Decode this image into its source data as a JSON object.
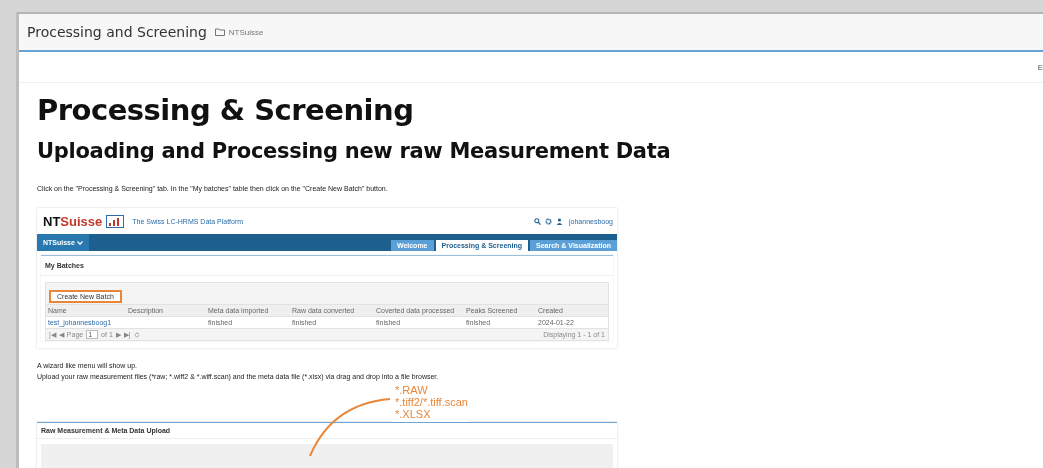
{
  "page_header": {
    "title": "Processing and Screening",
    "folder": "NTSuisse"
  },
  "toolbar": {
    "cut_text": "E"
  },
  "heading": "Processing & Screening",
  "subheading": "Uploading and Processing new raw Measurement Data",
  "intro": "Click on the \"Processing & Screening\" tab. In the \"My batches\" table then click on the \"Create New Batch\" button.",
  "screenshot_1": {
    "logo": [
      {
        "text": "NT",
        "kind": "dark"
      },
      {
        "text": "Suisse",
        "kind": "accent"
      }
    ],
    "tagline": "The Swiss LC-HRMS Data Platform",
    "user": "johannesboog",
    "menu": "NTSuisse",
    "tabs": [
      {
        "label": "Welcome",
        "selected": false
      },
      {
        "label": "Processing & Screening",
        "selected": true
      },
      {
        "label": "Search & Visualization",
        "selected": false
      }
    ],
    "panel_title": "My Batches",
    "button": "Create New Batch",
    "columns": [
      "Name",
      "Description",
      "Meta data imported",
      "Raw data converted",
      "Coverted data processed",
      "Peaks Screened",
      "Created"
    ],
    "rows": [
      [
        "test_johannesboog1",
        "",
        "finished",
        "finished",
        "finished",
        "finished",
        "2024-01-22"
      ]
    ],
    "pager": {
      "first": "|◀",
      "previous": "◀",
      "next": "▶",
      "last": "▶|",
      "page_label": "Page",
      "page": "1",
      "of": "of 1",
      "displaying": "Displaying 1 - 1 of 1"
    }
  },
  "instructions": [
    "A wizard like menu will show up.",
    "Upload your raw measurement files (*raw; *.wiff2 & *.wiff.scan) and the meta data file  (*.xlsx) via drag and drop into a file browser."
  ],
  "annotation": [
    "*.RAW",
    "*.tiff2/*.tiff.scan",
    "*.XLSX"
  ],
  "screenshot_2": {
    "panel_title": "Raw Measurement & Meta Data Upload"
  }
}
